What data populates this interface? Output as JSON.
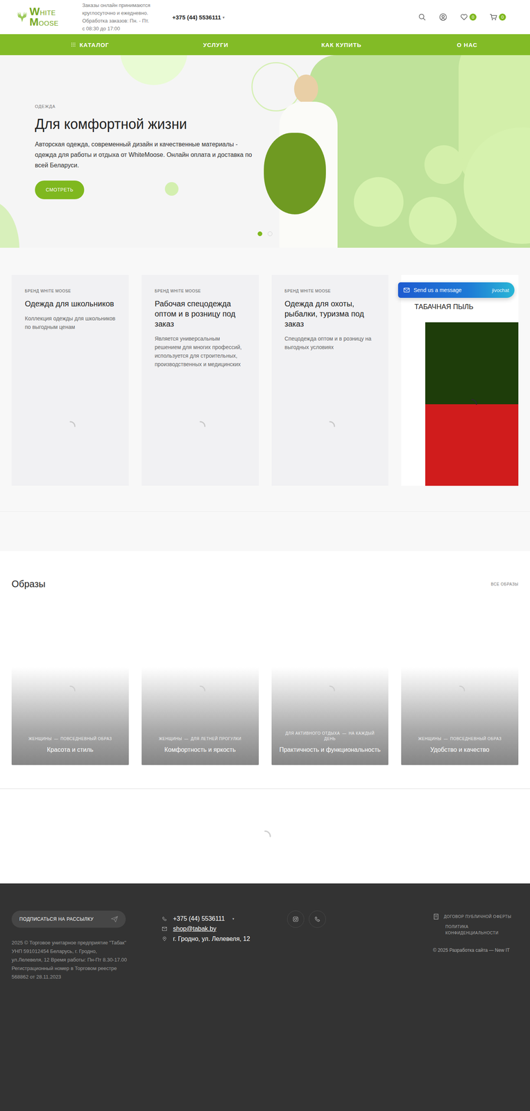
{
  "header": {
    "logo_top": "WHITE",
    "logo_bottom": "MOOSE",
    "notice_lines": [
      "Заказы онлайн принимаются",
      "круглосуточно и ежедневно.",
      "Обработка заказов: Пн. - Пт.",
      "с 08:30 до 17:00"
    ],
    "phone": "+375 (44) 5536111",
    "phone_caret": "▾",
    "favorites_count": "0",
    "cart_count": "0"
  },
  "nav": [
    {
      "label": "КАТАЛОГ",
      "kind": "menu"
    },
    {
      "label": "УСЛУГИ",
      "kind": "link"
    },
    {
      "label": "КАК КУПИТЬ",
      "kind": "link"
    },
    {
      "label": "О НАС",
      "kind": "link"
    }
  ],
  "hero": {
    "kicker": "ОДЕЖДА",
    "title": "Для комфортной жизни",
    "text": "Авторская одежда, современный дизайн и качественные материалы - одежда для работы и отдыха от WhiteMoose. Онлайн оплата и доставка по всей Беларуси.",
    "button": "СМОТРЕТЬ",
    "dots": [
      {
        "selected": true
      },
      {
        "selected": false
      }
    ]
  },
  "cards": [
    {
      "kind": "loading",
      "kicker": "БРЕНД WHITE MOOSE",
      "title": "Одежда для школьников",
      "text": "Коллекция одежды для школьников по выгодным ценам"
    },
    {
      "kind": "loading",
      "kicker": "БРЕНД WHITE MOOSE",
      "title": "Рабочая спецодежда оптом и в розницу под заказ",
      "text": "Является универсальным решением для многих профессий, используется для строительных, производственных и медицинских"
    },
    {
      "kind": "loading",
      "kicker": "БРЕНД WHITE MOOSE",
      "title": "Одежда для охоты, рыбалки, туризма под заказ",
      "text": "Спецодежда оптом и в розницу на выгодных условиях"
    },
    {
      "kind": "image",
      "kicker": "",
      "title": "ТАБАЧНАЯ ПЫЛЬ",
      "text": ""
    }
  ],
  "chat": {
    "label": "Send us a message",
    "brand": "jivochat"
  },
  "looks": {
    "title": "Образы",
    "all_link": "ВСЕ ОБРАЗЫ",
    "tag_separator": "—",
    "items": [
      {
        "tags": [
          "ЖЕНЩИНЫ",
          "ПОВСЕДНЕВНЫЙ ОБРАЗ"
        ],
        "title": "Красота и стиль"
      },
      {
        "tags": [
          "ЖЕНЩИНЫ",
          "ДЛЯ ЛЕТНЕЙ ПРОГУЛКИ"
        ],
        "title": "Комфортность и яркость"
      },
      {
        "tags": [
          "ДЛЯ АКТИВНОГО ОТДЫХА",
          "НА КАЖДЫЙ ДЕНЬ"
        ],
        "title": "Практичность и функциональность"
      },
      {
        "tags": [
          "ЖЕНЩИНЫ",
          "ПОВСЕДНЕВНЫЙ ОБРАЗ"
        ],
        "title": "Удобство и качество"
      }
    ]
  },
  "footer": {
    "subscribe": "ПОДПИСАТЬСЯ НА РАССЫЛКУ",
    "legal": "2025 © Торговое унитарное предприятие \"Табак\" УНП 591012454 Беларусь, г. Гродно, ул.Лелевеля, 12 Время работы: Пн-Пт 8.30-17.00 Регистрационный номер в Торговом реестре 568862 от 28.11.2023",
    "phone": "+375 (44) 5536111",
    "phone_caret": "▾",
    "email": "shop@tabak.by",
    "address": "г. Гродно, ул. Лелевеля, 12",
    "offer": "ДОГОВОР ПУБЛИЧНОЙ ОФЕРТЫ",
    "policy": "ПОЛИТИКА КОНФИДЕНЦИАЛЬНОСТИ",
    "copyright": "© 2025 Разработка сайта — New IT"
  }
}
